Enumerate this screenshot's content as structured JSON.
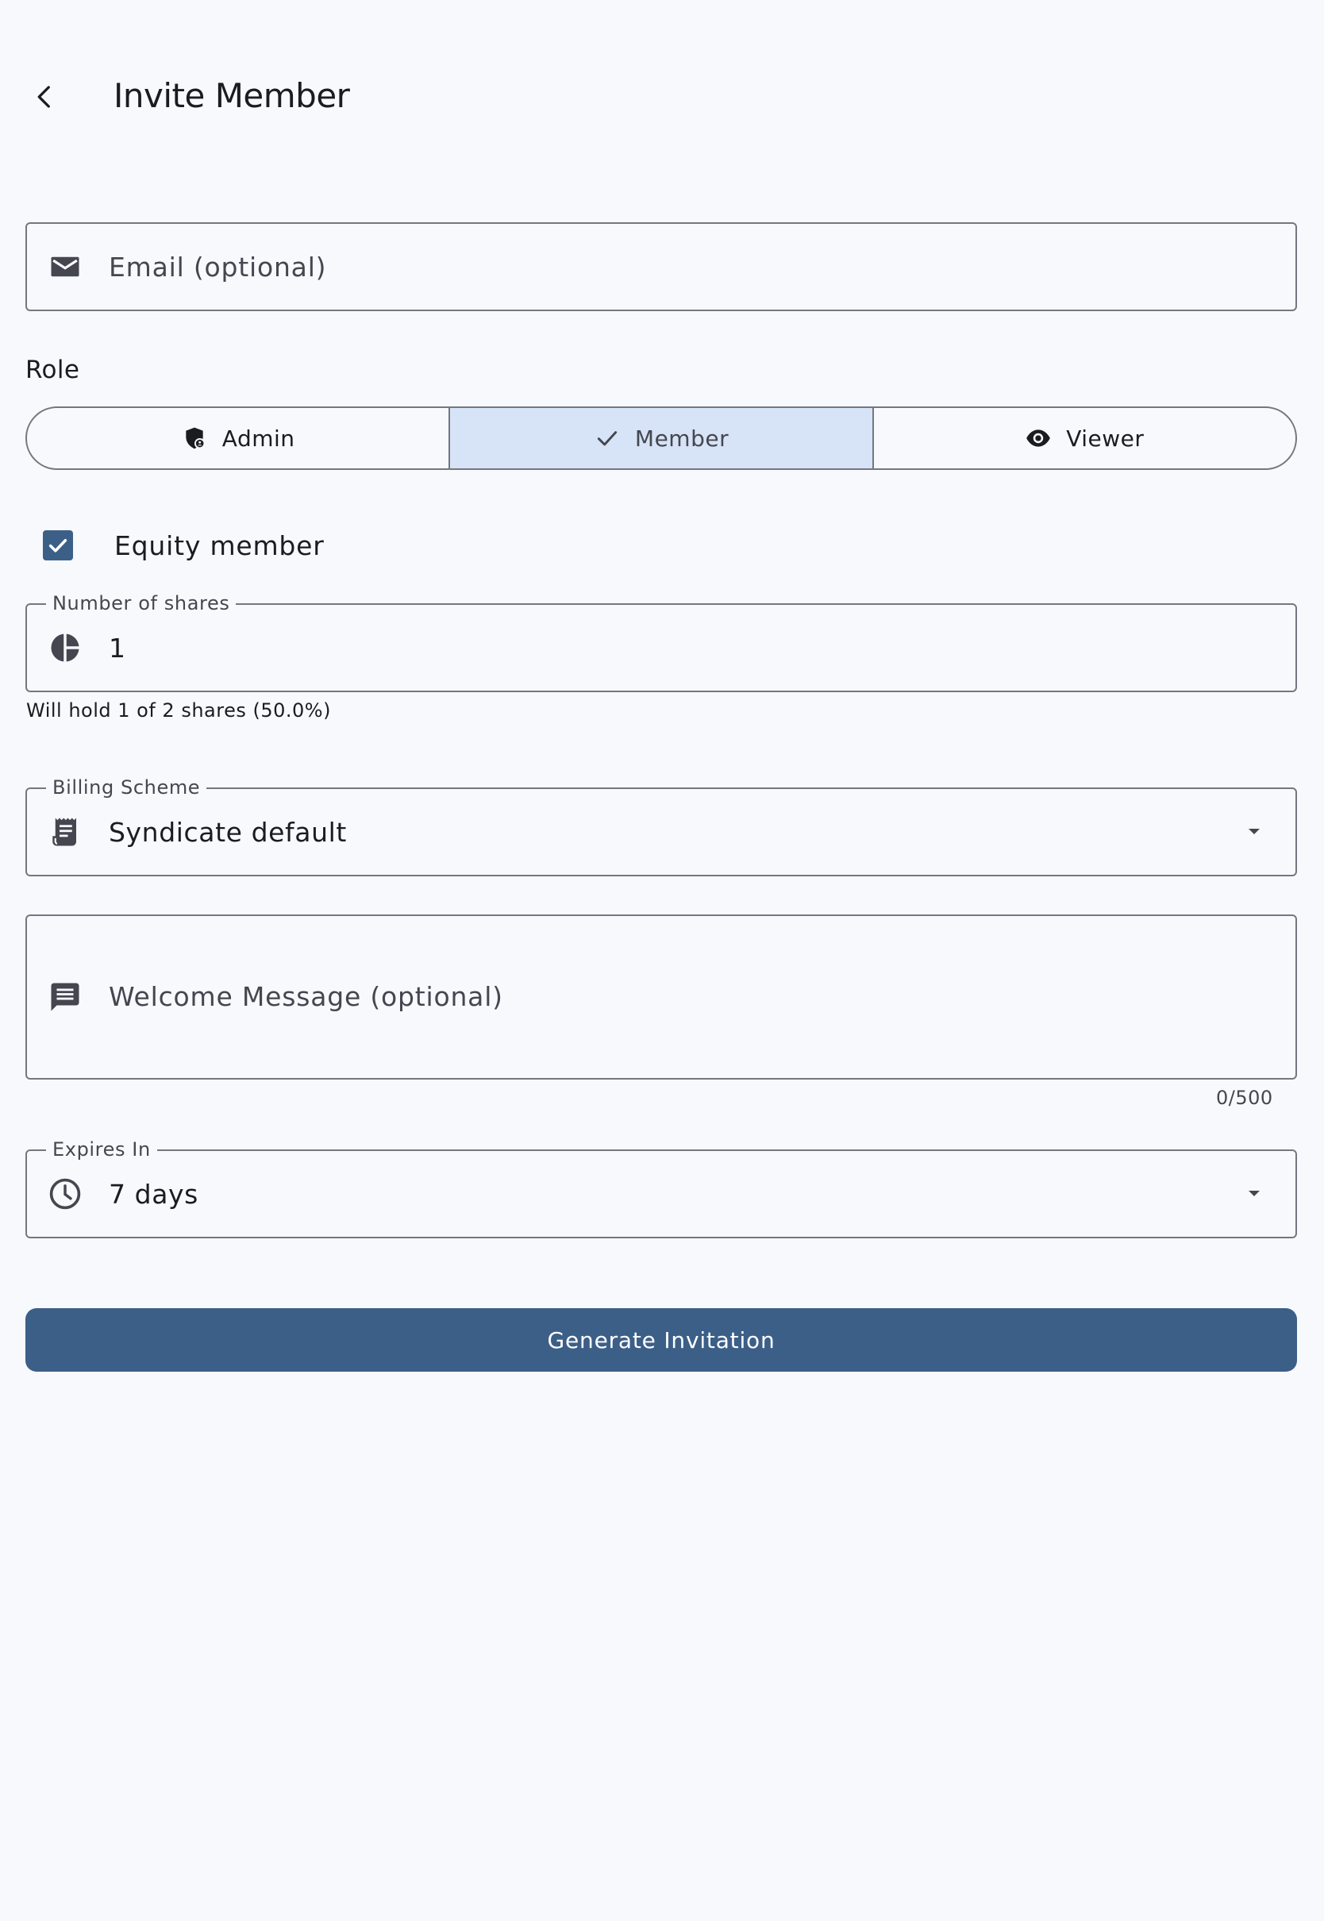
{
  "app_bar": {
    "title": "Invite Member",
    "back_icon": "arrow-back-icon"
  },
  "email": {
    "placeholder": "Email (optional)",
    "value": "",
    "icon": "mail-icon"
  },
  "role": {
    "label": "Role",
    "options": [
      {
        "label": "Admin",
        "icon": "admin-shield-icon",
        "selected": false
      },
      {
        "label": "Member",
        "icon": "check-icon",
        "selected": true
      },
      {
        "label": "Viewer",
        "icon": "eye-icon",
        "selected": false
      }
    ]
  },
  "equity": {
    "label": "Equity member",
    "checked": true
  },
  "shares": {
    "label": "Number of shares",
    "value": "1",
    "icon": "pie-chart-icon",
    "helper": "Will hold 1 of 2 shares (50.0%)"
  },
  "billing": {
    "label": "Billing Scheme",
    "value": "Syndicate default",
    "icon": "receipt-icon"
  },
  "welcome": {
    "placeholder": "Welcome Message (optional)",
    "value": "",
    "icon": "message-icon",
    "counter": "0/500"
  },
  "expires": {
    "label": "Expires In",
    "value": "7 days",
    "icon": "clock-icon"
  },
  "submit": {
    "label": "Generate Invitation"
  },
  "colors": {
    "background": "#f7f9fd",
    "primary": "#3c5f88",
    "selected_segment": "#d7e3f7",
    "outline": "#74777f"
  }
}
